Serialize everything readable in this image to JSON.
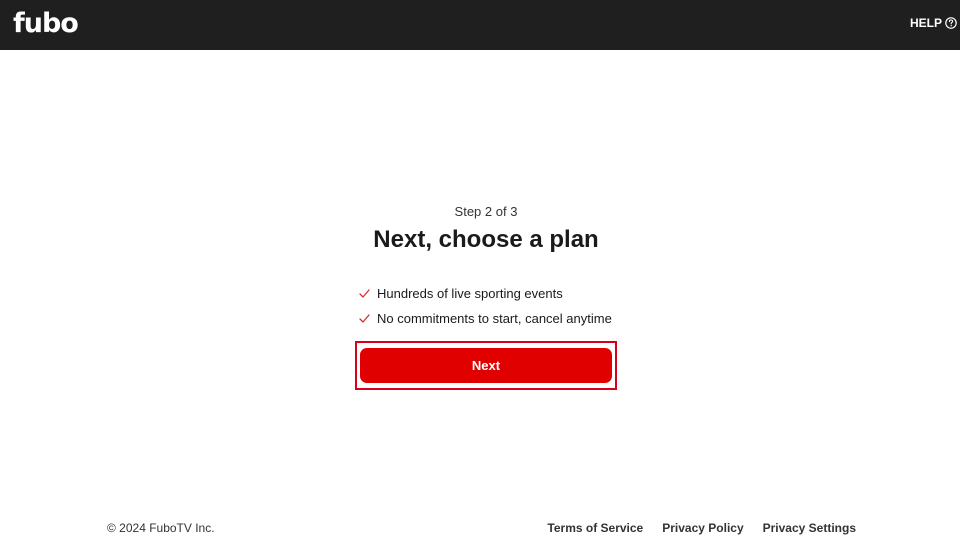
{
  "header": {
    "logo_text": "fubo",
    "help_label": "HELP",
    "help_icon": "question-circle-icon"
  },
  "main": {
    "step": "Step 2 of 3",
    "title": "Next, choose a plan",
    "benefits": [
      {
        "icon": "check-icon",
        "text": "Hundreds of live sporting events"
      },
      {
        "icon": "check-icon",
        "text": "No commitments to start, cancel anytime"
      }
    ],
    "next_label": "Next"
  },
  "footer": {
    "copyright": "© 2024 FuboTV Inc.",
    "links": [
      "Terms of Service",
      "Privacy Policy",
      "Privacy Settings"
    ]
  },
  "colors": {
    "topbar": "#1f1f1f",
    "accent": "#e00000",
    "check": "#d32f2f"
  }
}
